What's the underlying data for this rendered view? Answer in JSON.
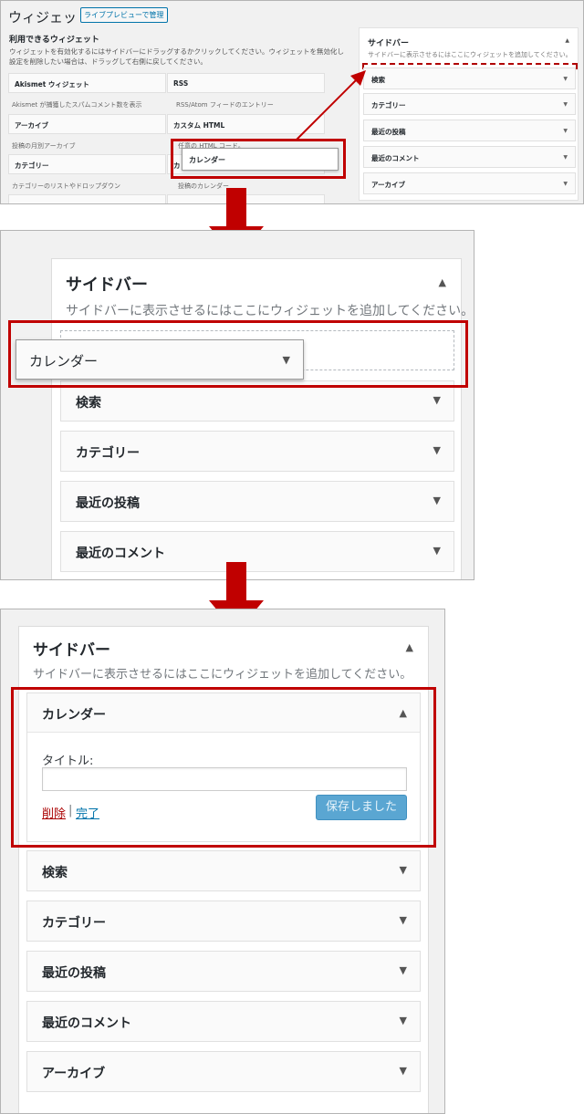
{
  "panel1": {
    "page_title": "ウィジェット",
    "live_preview_button": "ライブプレビューで管理",
    "available_heading": "利用できるウィジェット",
    "available_desc": "ウィジェットを有効化するにはサイドバーにドラッグするかクリックしてください。ウィジェットを無効化し設定を削除したい場合は、ドラッグして右側に戻してください。",
    "widgets": [
      {
        "name": "Akismet ウィジェット",
        "desc": "Akismet が捕獲したスパムコメント数を表示"
      },
      {
        "name": "RSS",
        "desc": "RSS/Atom フィードのエントリー"
      },
      {
        "name": "アーカイブ",
        "desc": "投稿の月別アーカイブ"
      },
      {
        "name": "カスタム HTML",
        "desc": "任意の HTML コード。"
      },
      {
        "name": "カテゴリー",
        "desc": "カテゴリーのリストやドロップダウン"
      },
      {
        "name": "カ",
        "desc": "投稿のカレンダー"
      }
    ],
    "dragging_widget": "カレンダー",
    "sidebar_title": "サイドバー",
    "sidebar_desc": "サイドバーに表示させるにはここにウィジェットを追加してください。",
    "sidebar_widgets": [
      "検索",
      "カテゴリー",
      "最近の投稿",
      "最近のコメント",
      "アーカイブ"
    ]
  },
  "panel2": {
    "sidebar_title": "サイドバー",
    "sidebar_desc": "サイドバーに表示させるにはここにウィジェットを追加してください。",
    "dragging_widget": "カレンダー",
    "sidebar_widgets": [
      "検索",
      "カテゴリー",
      "最近の投稿",
      "最近のコメント"
    ]
  },
  "panel3": {
    "sidebar_title": "サイドバー",
    "sidebar_desc": "サイドバーに表示させるにはここにウィジェットを追加してください。",
    "open_widget": {
      "name": "カレンダー",
      "field_label": "タイトル:",
      "field_value": "",
      "delete_link": "削除",
      "separator": "|",
      "done_link": "完了",
      "save_button": "保存しました"
    },
    "sidebar_widgets": [
      "検索",
      "カテゴリー",
      "最近の投稿",
      "最近のコメント",
      "アーカイブ"
    ]
  },
  "colors": {
    "highlight": "#c00000",
    "link": "#0073aa",
    "delete": "#aa0000",
    "saved_button": "#5aa6d2"
  },
  "icons": {
    "collapse": "▲",
    "expand": "▼",
    "flow_arrow": "down-arrow-icon",
    "drag_arrow": "diagonal-arrow-icon"
  }
}
